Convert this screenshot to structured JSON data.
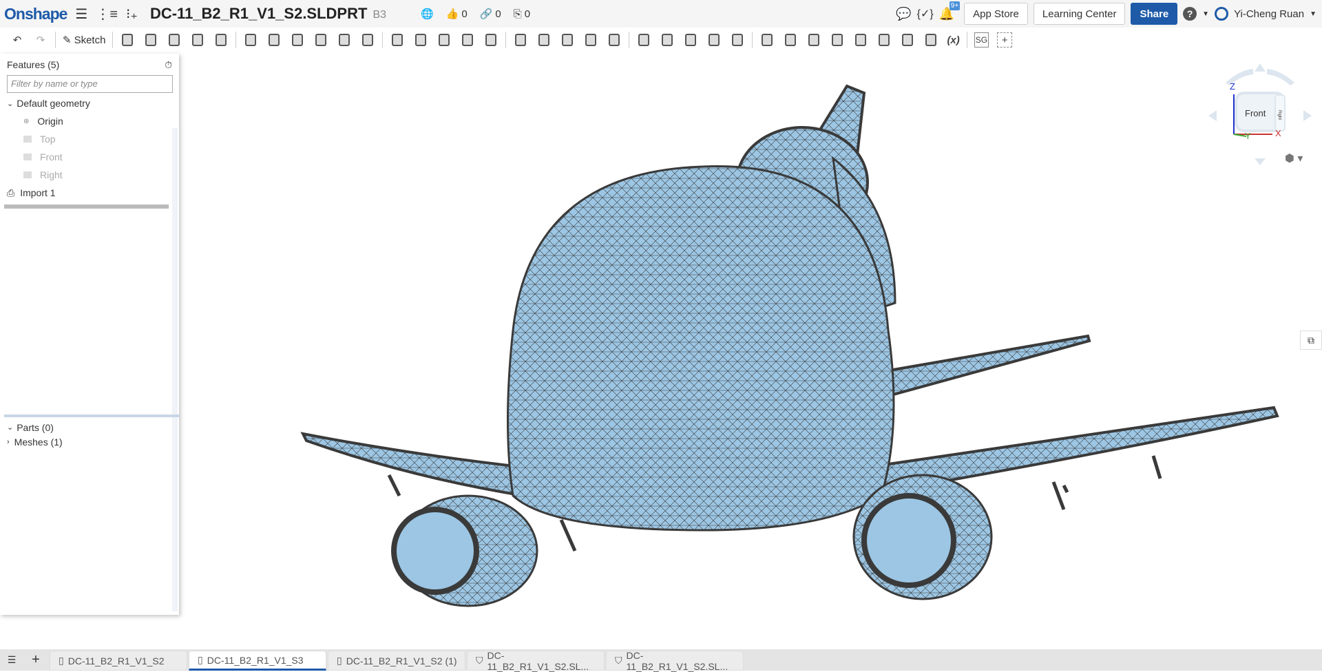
{
  "header": {
    "logo": "Onshape",
    "doc_title": "DC-11_B2_R1_V1_S2.SLDPRT",
    "workspace": "B3",
    "likes": "0",
    "links": "0",
    "copies": "0",
    "notifications_badge": "9+",
    "app_store": "App Store",
    "learning_center": "Learning Center",
    "share": "Share",
    "help": "?",
    "user": "Yi-Cheng Ruan"
  },
  "toolbar": {
    "sketch": "Sketch",
    "variable": "(x)",
    "sg": "SG",
    "icons": [
      "extrude",
      "revolve",
      "sweep",
      "loft",
      "thicken",
      "fillet",
      "chamfer",
      "draft",
      "rib",
      "shell",
      "hole",
      "pattern",
      "mirror",
      "boolean",
      "split",
      "transform",
      "delete-part",
      "move-face",
      "replace-face",
      "offset-surface",
      "fill",
      "plane",
      "helix",
      "mate-connector",
      "derive",
      "variable",
      "sheet-metal",
      "flange",
      "tab",
      "bend",
      "form",
      "joint",
      "finish",
      "custom-feature",
      "add-feature"
    ]
  },
  "panel": {
    "features_title": "Features (5)",
    "filter_placeholder": "Filter by name or type",
    "default_geometry": "Default geometry",
    "items": [
      "Origin",
      "Top",
      "Front",
      "Right"
    ],
    "import": "Import 1",
    "parts": "Parts (0)",
    "meshes": "Meshes (1)"
  },
  "viewcube": {
    "front": "Front",
    "right": "Right",
    "x": "X",
    "y": "Y",
    "z": "Z"
  },
  "colors": {
    "accent": "#1e5aa8",
    "mesh_fill": "#9cc6e4",
    "mesh_edge": "#3a3a3a"
  },
  "tabs": [
    {
      "label": "DC-11_B2_R1_V1_S2",
      "icon": "part-studio"
    },
    {
      "label": "DC-11_B2_R1_V1_S3",
      "icon": "part-studio",
      "active": true
    },
    {
      "label": "DC-11_B2_R1_V1_S2 (1)",
      "icon": "part-studio"
    },
    {
      "label": "DC-11_B2_R1_V1_S2.SL...",
      "icon": "solidworks-file"
    },
    {
      "label": "DC-11_B2_R1_V1_S2.SL...",
      "icon": "solidworks-file"
    }
  ]
}
